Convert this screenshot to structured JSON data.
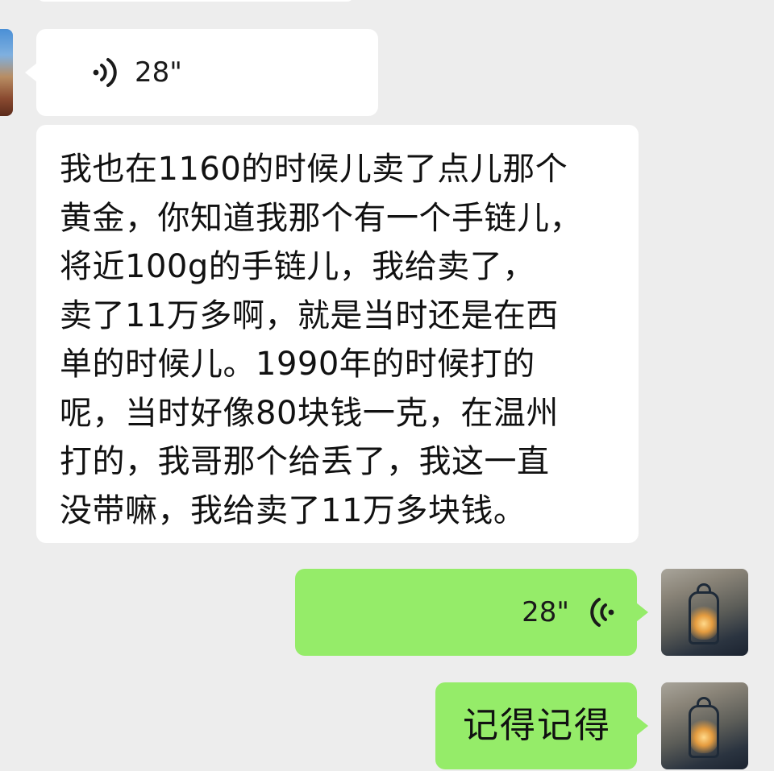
{
  "messages": [
    {
      "type": "voice",
      "sender": "other",
      "duration": "28\"",
      "icon": "voice-wave-icon"
    },
    {
      "type": "text",
      "sender": "other",
      "text": "我也在1160的时候儿卖了点儿那个\n黄金，你知道我那个有一个手链儿，\n将近100g的手链儿，我给卖了，\n卖了11万多啊，就是当时还是在西\n单的时候儿。1990年的时候打的\n呢，当时好像80块钱一克，在温州\n打的，我哥那个给丢了，我这一直\n没带嘛，我给卖了11万多块钱。"
    },
    {
      "type": "voice",
      "sender": "me",
      "duration": "28\"",
      "icon": "voice-wave-icon"
    },
    {
      "type": "text",
      "sender": "me",
      "text": "记得记得"
    }
  ],
  "colors": {
    "background": "#ededed",
    "incoming_bubble": "#ffffff",
    "outgoing_bubble": "#95ec69"
  }
}
